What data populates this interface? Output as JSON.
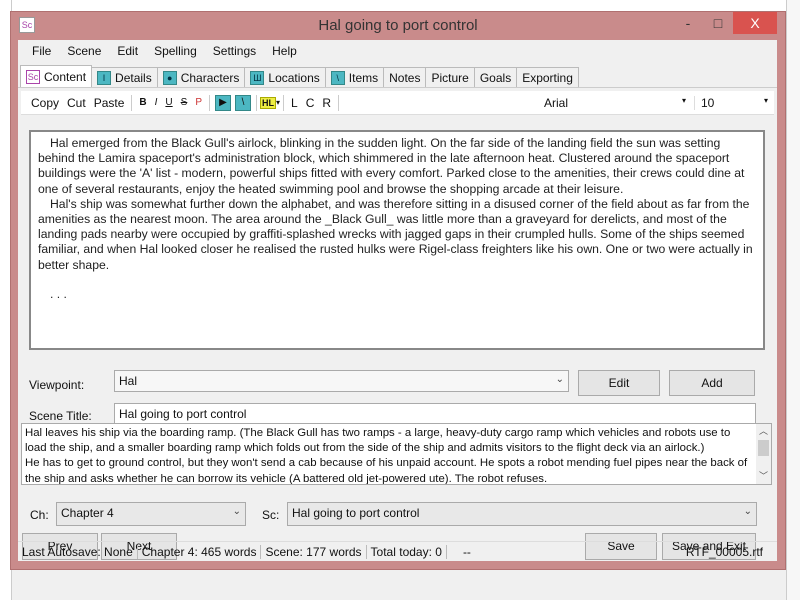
{
  "window": {
    "title": "Hal going to port control",
    "app_icon": "Sc",
    "minimize": "-",
    "maximize": "□",
    "close": "X"
  },
  "menu": [
    "File",
    "Scene",
    "Edit",
    "Spelling",
    "Settings",
    "Help"
  ],
  "tabs": [
    "Content",
    "Details",
    "Characters",
    "Locations",
    "Items",
    "Notes",
    "Picture",
    "Goals",
    "Exporting"
  ],
  "toolbar": {
    "copy": "Copy",
    "cut": "Cut",
    "paste": "Paste",
    "bold": "B",
    "italic": "I",
    "underline": "U",
    "strike": "S",
    "p": "P",
    "hl": "HL",
    "left": "L",
    "center": "C",
    "right": "R",
    "font": "Arial",
    "size": "10"
  },
  "editor": {
    "paragraphs": [
      "Hal emerged from the Black Gull's airlock, blinking in the sudden light. On the far side of the landing field the sun was setting behind the Lamira spaceport's administration block, which shimmered in the late afternoon heat. Clustered around the spaceport buildings were the 'A' list - modern, powerful ships fitted with every comfort. Parked close to the amenities, their crews could dine at one of several restaurants, enjoy the heated swimming pool and browse the shopping arcade at their leisure.",
      "Hal's ship was somewhat further down the alphabet, and was therefore sitting in a disused corner of the field about as far from the amenities as the nearest moon. The area around the _Black Gull_ was little more than a graveyard for derelicts, and most of the landing pads nearby were occupied by graffiti-splashed wrecks with jagged gaps in their crumpled hulls. Some of the ships seemed familiar, and when Hal looked closer he realised the rusted hulks were Rigel-class freighters like his own. One or two were actually in better shape."
    ],
    "ellipsis": ". . ."
  },
  "viewpoint": {
    "label": "Viewpoint:",
    "value": "Hal",
    "edit": "Edit",
    "add": "Add"
  },
  "scene_title": {
    "label": "Scene Title:",
    "value": "Hal going to port control"
  },
  "summary": "Hal leaves his ship via the boarding ramp. (The Black Gull has two ramps - a large, heavy-duty cargo ramp which vehicles and robots use to load the ship, and a smaller boarding ramp which folds out from the side of the ship and admits visitors to the flight deck via an airlock.)\nHe has to get to ground control, but they won't send a cab because of his unpaid account. He spots a robot mending fuel pipes near the back of the ship and asks whether he can borrow its vehicle (A battered old jet-powered ute). The robot refuses.",
  "chapter": {
    "label": "Ch:",
    "value": "Chapter 4"
  },
  "scene": {
    "label": "Sc:",
    "value": "Hal going to port control"
  },
  "buttons": {
    "prev": "Prev",
    "next": "Next",
    "save": "Save",
    "save_exit": "Save and Exit"
  },
  "status": {
    "autosave": "Last Autosave: None",
    "chapter": "Chapter 4: 465 words",
    "scene": "Scene: 177 words",
    "today": "Total today: 0",
    "dash": "--",
    "file": "RTF_00005.rtf"
  },
  "colors": {
    "frame": "#c98b8b",
    "close": "#d9534f",
    "icon_teal": "#4cb7c2"
  }
}
